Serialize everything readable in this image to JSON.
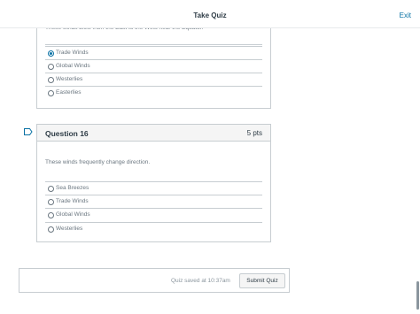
{
  "topbar": {
    "title": "Take Quiz",
    "exit_label": "Exit"
  },
  "previous_question": {
    "text": "These winds blow from the East to the West near the Equator.",
    "answers": [
      {
        "label": "Trade Winds",
        "selected": true
      },
      {
        "label": "Global Winds",
        "selected": false
      },
      {
        "label": "Westerlies",
        "selected": false
      },
      {
        "label": "Easterlies",
        "selected": false
      }
    ]
  },
  "question": {
    "title": "Question 16",
    "points": "5 pts",
    "text": "These winds frequently change direction.",
    "answers": [
      {
        "label": "Sea Breezes",
        "selected": false
      },
      {
        "label": "Trade Winds",
        "selected": false
      },
      {
        "label": "Global Winds",
        "selected": false
      },
      {
        "label": "Westerlies",
        "selected": false
      }
    ]
  },
  "footer": {
    "saved_text": "Quiz saved at 10:37am",
    "submit_label": "Submit Quiz"
  },
  "colors": {
    "accent": "#0770a3",
    "text": "#2d3b45",
    "muted": "#6b7780",
    "border": "#c7cdd1"
  }
}
